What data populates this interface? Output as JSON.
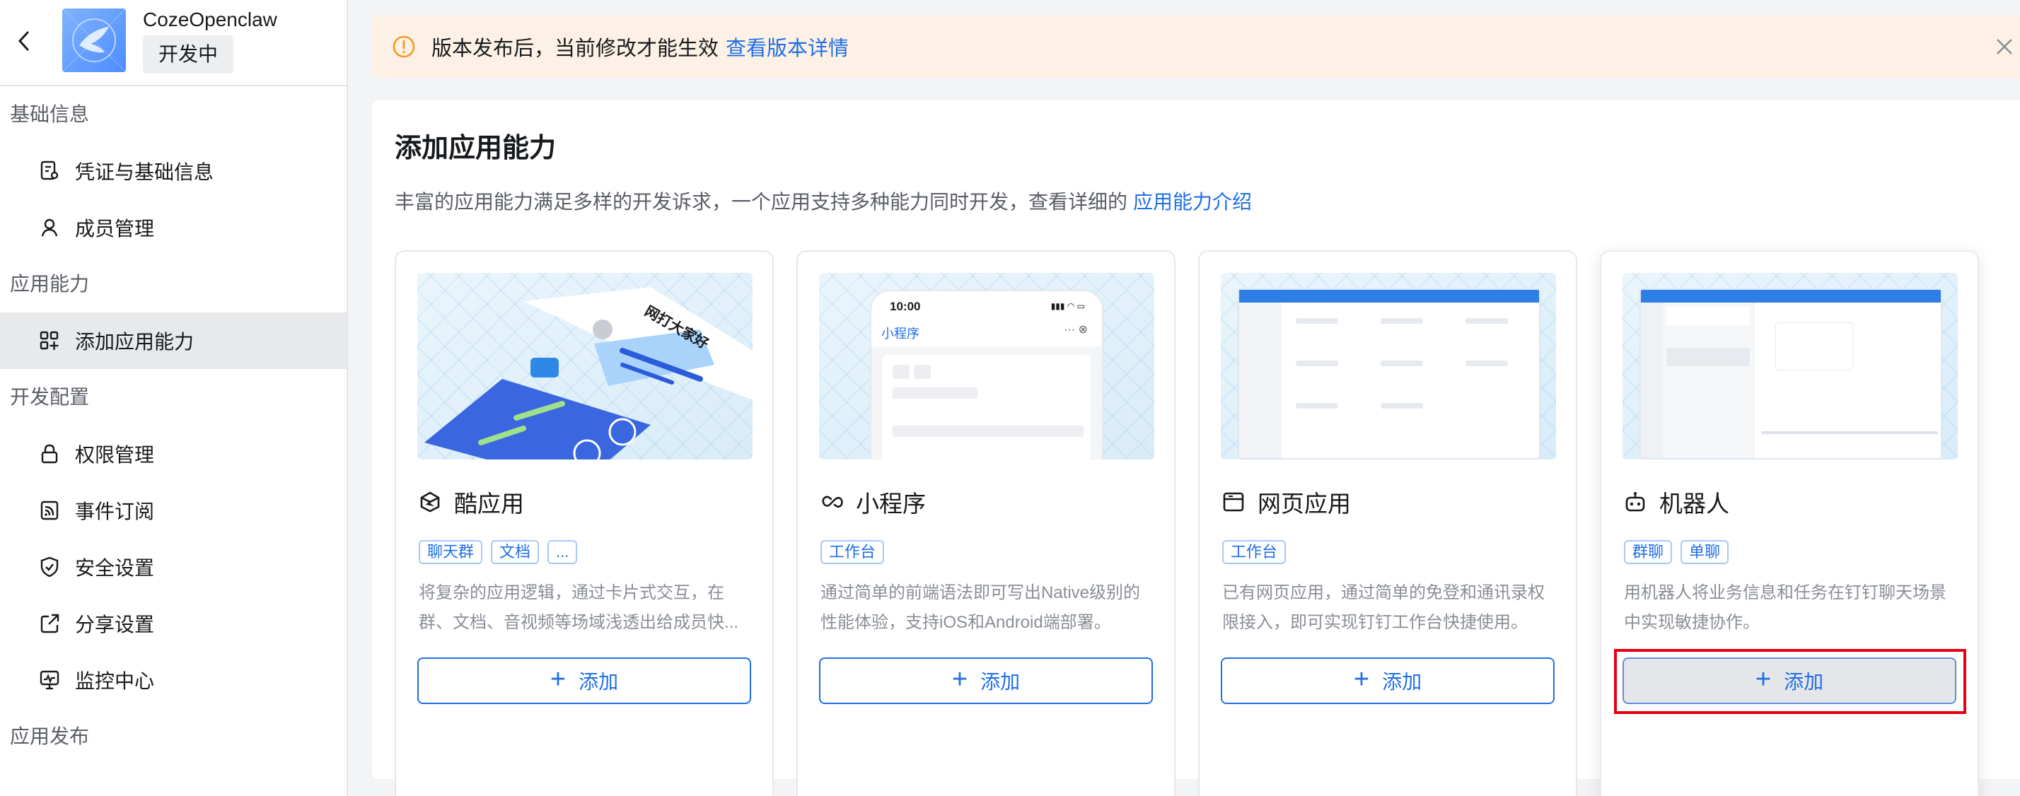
{
  "app": {
    "name": "CozeOpenclaw",
    "status": "开发中"
  },
  "sidebar": {
    "groups": [
      {
        "label": "基础信息",
        "items": [
          {
            "label": "凭证与基础信息",
            "icon": "credential-icon"
          },
          {
            "label": "成员管理",
            "icon": "user-icon"
          }
        ]
      },
      {
        "label": "应用能力",
        "items": [
          {
            "label": "添加应用能力",
            "icon": "grid-add-icon",
            "active": true
          }
        ]
      },
      {
        "label": "开发配置",
        "items": [
          {
            "label": "权限管理",
            "icon": "lock-icon"
          },
          {
            "label": "事件订阅",
            "icon": "rss-icon"
          },
          {
            "label": "安全设置",
            "icon": "shield-icon"
          },
          {
            "label": "分享设置",
            "icon": "share-icon"
          },
          {
            "label": "监控中心",
            "icon": "monitor-icon"
          }
        ]
      },
      {
        "label": "应用发布",
        "items": []
      }
    ]
  },
  "notice": {
    "text": "版本发布后，当前修改才能生效",
    "link": "查看版本详情"
  },
  "main": {
    "title": "添加应用能力",
    "description": "丰富的应用能力满足多样的开发诉求，一个应用支持多种能力同时开发，查看详细的",
    "description_link": "应用能力介绍",
    "cards": [
      {
        "title": "酷应用",
        "icon": "cube-app-icon",
        "tags": [
          "聊天群",
          "文档",
          "..."
        ],
        "description": "将复杂的应用逻辑，通过卡片式交互，在群、文档、音视频等场域浅透出给成员快...",
        "add_label": "添加",
        "thumb_text": "网打大家好"
      },
      {
        "title": "小程序",
        "icon": "link-icon",
        "tags": [
          "工作台"
        ],
        "description": "通过简单的前端语法即可写出Native级别的性能体验，支持iOS和Android端部署。",
        "add_label": "添加",
        "phone_time": "10:00",
        "phone_title": "小程序"
      },
      {
        "title": "网页应用",
        "icon": "window-icon",
        "tags": [
          "工作台"
        ],
        "description": "已有网页应用，通过简单的免登和通讯录权限接入，即可实现钉钉工作台快捷使用。",
        "add_label": "添加"
      },
      {
        "title": "机器人",
        "icon": "robot-icon",
        "tags": [
          "群聊",
          "单聊"
        ],
        "description": "用机器人将业务信息和任务在钉钉聊天场景中实现敏捷协作。",
        "add_label": "添加"
      }
    ]
  },
  "colors": {
    "accent": "#1f6fe6",
    "notice_bg": "#fdf1e6",
    "highlight": "#e60012"
  }
}
